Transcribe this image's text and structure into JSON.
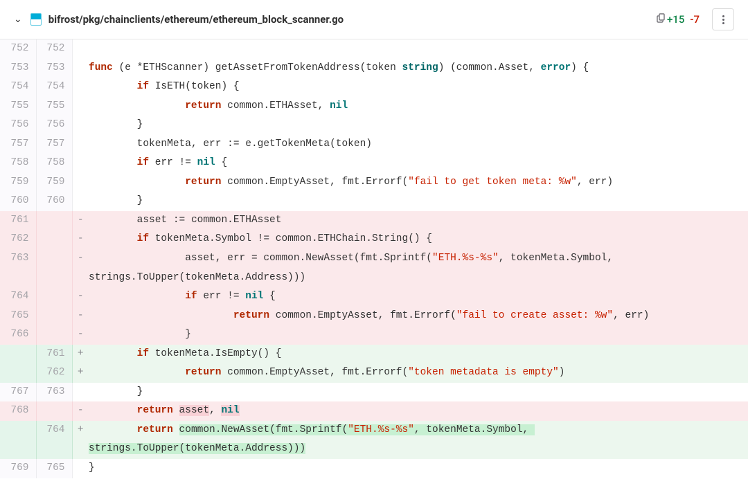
{
  "header": {
    "file_path": "bifrost/pkg/chainclients/ethereum/ethereum_block_scanner.go",
    "additions": "+15",
    "deletions": "-7"
  },
  "diff": [
    {
      "type": "ctx",
      "old": "752",
      "new": "752",
      "code": ""
    },
    {
      "type": "ctx",
      "old": "753",
      "new": "753",
      "code": "<span class='kw'>func</span> (e *ETHScanner) getAssetFromTokenAddress(token <span class='typ'>string</span>) (common.Asset, <span class='builtin'>error</span>) {"
    },
    {
      "type": "ctx",
      "old": "754",
      "new": "754",
      "code": "        <span class='kw'>if</span> IsETH(token) {"
    },
    {
      "type": "ctx",
      "old": "755",
      "new": "755",
      "code": "                <span class='kw'>return</span> common.ETHAsset, <span class='null'>nil</span>"
    },
    {
      "type": "ctx",
      "old": "756",
      "new": "756",
      "code": "        }"
    },
    {
      "type": "ctx",
      "old": "757",
      "new": "757",
      "code": "        tokenMeta, err := e.getTokenMeta(token)"
    },
    {
      "type": "ctx",
      "old": "758",
      "new": "758",
      "code": "        <span class='kw'>if</span> err != <span class='null'>nil</span> {"
    },
    {
      "type": "ctx",
      "old": "759",
      "new": "759",
      "code": "                <span class='kw'>return</span> common.EmptyAsset, fmt.Errorf(<span class='str'>\"fail to get token meta: %w\"</span>, err)"
    },
    {
      "type": "ctx",
      "old": "760",
      "new": "760",
      "code": "        }"
    },
    {
      "type": "del",
      "old": "761",
      "new": "",
      "code": "        asset := common.ETHAsset"
    },
    {
      "type": "del",
      "old": "762",
      "new": "",
      "code": "        <span class='kw'>if</span> tokenMeta.Symbol != common.ETHChain.String() {"
    },
    {
      "type": "del",
      "old": "763",
      "new": "",
      "code": "                asset, err = common.NewAsset(fmt.Sprintf(<span class='str'>\"ETH.%s-%s\"</span>, tokenMeta.Symbol, strings.ToUpper(tokenMeta.Address)))"
    },
    {
      "type": "del",
      "old": "764",
      "new": "",
      "code": "                <span class='kw'>if</span> err != <span class='null'>nil</span> {"
    },
    {
      "type": "del",
      "old": "765",
      "new": "",
      "code": "                        <span class='kw'>return</span> common.EmptyAsset, fmt.Errorf(<span class='str'>\"fail to create asset: %w\"</span>, err)"
    },
    {
      "type": "del",
      "old": "766",
      "new": "",
      "code": "                }"
    },
    {
      "type": "add",
      "old": "",
      "new": "761",
      "code": "        <span class='kw'>if</span> tokenMeta.IsEmpty() {"
    },
    {
      "type": "add",
      "old": "",
      "new": "762",
      "code": "                <span class='kw'>return</span> common.EmptyAsset, fmt.Errorf(<span class='str'>\"token metadata is empty\"</span>)"
    },
    {
      "type": "ctx",
      "old": "767",
      "new": "763",
      "code": "        }"
    },
    {
      "type": "del",
      "old": "768",
      "new": "",
      "code": "        <span class='kw'>return</span> <span class='hl-del'>asset</span>, <span class='hl-del null'>nil</span>"
    },
    {
      "type": "add",
      "old": "",
      "new": "764",
      "code": "        <span class='kw'>return</span> <span class='hl-add'>common.NewAsset(fmt.Sprintf(<span class='str'>\"ETH.%s-%s\"</span>, tokenMeta.Symbol, strings.ToUpper(tokenMeta.Address)))</span>"
    },
    {
      "type": "ctx",
      "old": "769",
      "new": "765",
      "code": "}"
    }
  ]
}
